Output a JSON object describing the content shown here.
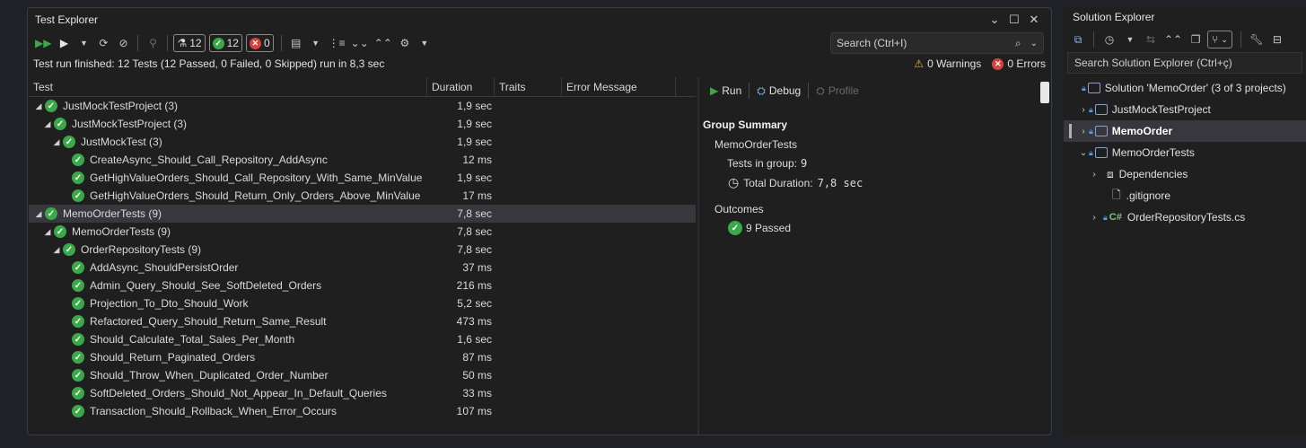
{
  "test_explorer": {
    "title": "Test Explorer",
    "counts": {
      "total": "12",
      "passed": "12",
      "failed": "0"
    },
    "search_placeholder": "Search (Ctrl+I)",
    "status_message": "Test run finished: 12 Tests (12 Passed, 0 Failed, 0 Skipped) run in 8,3 sec",
    "warnings": "0 Warnings",
    "errors": "0 Errors",
    "columns": {
      "test": "Test",
      "duration": "Duration",
      "traits": "Traits",
      "error": "Error Message"
    },
    "rows": [
      {
        "name": "JustMockTestProject  (3)",
        "duration": "1,9 sec"
      },
      {
        "name": "JustMockTestProject  (3)",
        "duration": "1,9 sec"
      },
      {
        "name": "JustMockTest  (3)",
        "duration": "1,9 sec"
      },
      {
        "name": "CreateAsync_Should_Call_Repository_AddAsync",
        "duration": "12 ms"
      },
      {
        "name": "GetHighValueOrders_Should_Call_Repository_With_Same_MinValue",
        "duration": "1,9 sec"
      },
      {
        "name": "GetHighValueOrders_Should_Return_Only_Orders_Above_MinValue",
        "duration": "17 ms"
      },
      {
        "name": "MemoOrderTests  (9)",
        "duration": "7,8 sec"
      },
      {
        "name": "MemoOrderTests  (9)",
        "duration": "7,8 sec"
      },
      {
        "name": "OrderRepositoryTests  (9)",
        "duration": "7,8 sec"
      },
      {
        "name": "AddAsync_ShouldPersistOrder",
        "duration": "37 ms"
      },
      {
        "name": "Admin_Query_Should_See_SoftDeleted_Orders",
        "duration": "216 ms"
      },
      {
        "name": "Projection_To_Dto_Should_Work",
        "duration": "5,2 sec"
      },
      {
        "name": "Refactored_Query_Should_Return_Same_Result",
        "duration": "473 ms"
      },
      {
        "name": "Should_Calculate_Total_Sales_Per_Month",
        "duration": "1,6 sec"
      },
      {
        "name": "Should_Return_Paginated_Orders",
        "duration": "87 ms"
      },
      {
        "name": "Should_Throw_When_Duplicated_Order_Number",
        "duration": "50 ms"
      },
      {
        "name": "SoftDeleted_Orders_Should_Not_Appear_In_Default_Queries",
        "duration": "33 ms"
      },
      {
        "name": "Transaction_Should_Rollback_When_Error_Occurs",
        "duration": "107 ms"
      }
    ],
    "detail": {
      "run": "Run",
      "debug": "Debug",
      "profile": "Profile",
      "group_summary": "Group Summary",
      "group_name": "MemoOrderTests",
      "tests_in_group_label": "Tests in group:",
      "tests_in_group_value": "9",
      "total_duration_label": "Total Duration:",
      "total_duration_value": "7,8 sec",
      "outcomes": "Outcomes",
      "passed": "9 Passed"
    }
  },
  "solution_explorer": {
    "title": "Solution Explorer",
    "search_placeholder": "Search Solution Explorer (Ctrl+ç)",
    "items": [
      {
        "label": "Solution 'MemoOrder' (3 of 3 projects)"
      },
      {
        "label": "JustMockTestProject"
      },
      {
        "label": "MemoOrder"
      },
      {
        "label": "MemoOrderTests"
      },
      {
        "label": "Dependencies"
      },
      {
        "label": ".gitignore"
      },
      {
        "label": "OrderRepositoryTests.cs"
      }
    ],
    "csharp_badge": "C#"
  }
}
